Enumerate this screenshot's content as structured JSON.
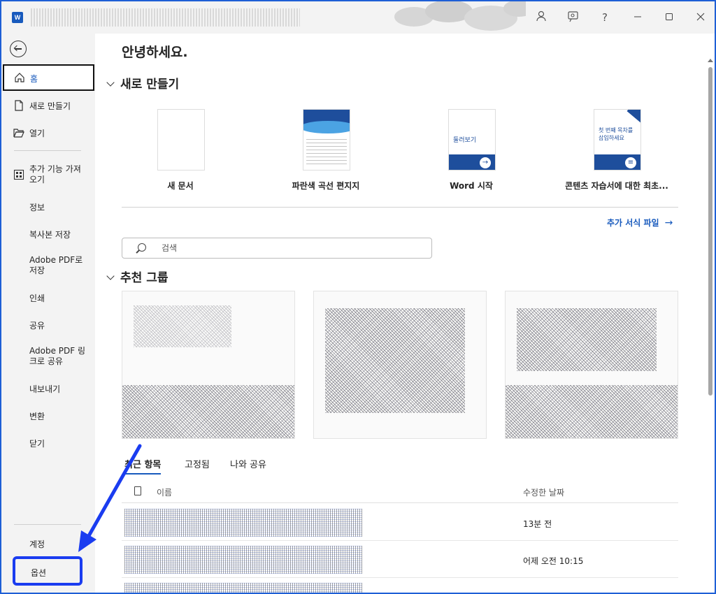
{
  "titlebar": {
    "app_icon_letter": "W",
    "help": "?"
  },
  "sidebar": {
    "items": [
      {
        "label": "홈"
      },
      {
        "label": "새로 만들기"
      },
      {
        "label": "열기"
      },
      {
        "label": "추가 기능 가져오기"
      },
      {
        "label": "정보"
      },
      {
        "label": "복사본 저장"
      },
      {
        "label": "Adobe PDF로 저장"
      },
      {
        "label": "인쇄"
      },
      {
        "label": "공유"
      },
      {
        "label": "Adobe PDF 링크로 공유"
      },
      {
        "label": "내보내기"
      },
      {
        "label": "변환"
      },
      {
        "label": "닫기"
      }
    ],
    "account": "계정",
    "options": "옵션"
  },
  "main": {
    "greeting": "안녕하세요.",
    "new_section": "새로 만들기",
    "templates": [
      {
        "caption": "새 문서"
      },
      {
        "caption": "파란색 곡선 편지지"
      },
      {
        "caption": "Word 시작",
        "thumb_text": "둘러보기"
      },
      {
        "caption": "콘텐츠 자습서에 대한 최초...",
        "thumb_text": "첫 번째 목차를 삽입하세요"
      }
    ],
    "more_templates": "추가 서식 파일",
    "search_placeholder": "검색",
    "recommended_section": "추천 그룹",
    "tabs": [
      "최근 항목",
      "고정됨",
      "나와 공유"
    ],
    "list": {
      "col_name": "이름",
      "col_date": "수정한 날짜",
      "rows": [
        {
          "date": "13분 전"
        },
        {
          "date": "어제 오전 10:15"
        },
        {
          "date": ""
        }
      ]
    }
  },
  "colors": {
    "accent": "#185abd",
    "annotation": "#1a3cf0",
    "frame": "#1e5fd6"
  }
}
